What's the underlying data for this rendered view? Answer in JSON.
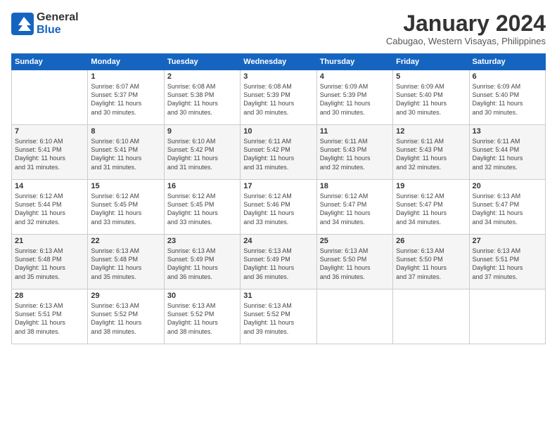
{
  "header": {
    "logo_line1": "General",
    "logo_line2": "Blue",
    "month": "January 2024",
    "location": "Cabugao, Western Visayas, Philippines"
  },
  "days_of_week": [
    "Sunday",
    "Monday",
    "Tuesday",
    "Wednesday",
    "Thursday",
    "Friday",
    "Saturday"
  ],
  "weeks": [
    [
      {
        "day": "",
        "text": ""
      },
      {
        "day": "1",
        "text": "Sunrise: 6:07 AM\nSunset: 5:37 PM\nDaylight: 11 hours\nand 30 minutes."
      },
      {
        "day": "2",
        "text": "Sunrise: 6:08 AM\nSunset: 5:38 PM\nDaylight: 11 hours\nand 30 minutes."
      },
      {
        "day": "3",
        "text": "Sunrise: 6:08 AM\nSunset: 5:39 PM\nDaylight: 11 hours\nand 30 minutes."
      },
      {
        "day": "4",
        "text": "Sunrise: 6:09 AM\nSunset: 5:39 PM\nDaylight: 11 hours\nand 30 minutes."
      },
      {
        "day": "5",
        "text": "Sunrise: 6:09 AM\nSunset: 5:40 PM\nDaylight: 11 hours\nand 30 minutes."
      },
      {
        "day": "6",
        "text": "Sunrise: 6:09 AM\nSunset: 5:40 PM\nDaylight: 11 hours\nand 30 minutes."
      }
    ],
    [
      {
        "day": "7",
        "text": "Sunrise: 6:10 AM\nSunset: 5:41 PM\nDaylight: 11 hours\nand 31 minutes."
      },
      {
        "day": "8",
        "text": "Sunrise: 6:10 AM\nSunset: 5:41 PM\nDaylight: 11 hours\nand 31 minutes."
      },
      {
        "day": "9",
        "text": "Sunrise: 6:10 AM\nSunset: 5:42 PM\nDaylight: 11 hours\nand 31 minutes."
      },
      {
        "day": "10",
        "text": "Sunrise: 6:11 AM\nSunset: 5:42 PM\nDaylight: 11 hours\nand 31 minutes."
      },
      {
        "day": "11",
        "text": "Sunrise: 6:11 AM\nSunset: 5:43 PM\nDaylight: 11 hours\nand 32 minutes."
      },
      {
        "day": "12",
        "text": "Sunrise: 6:11 AM\nSunset: 5:43 PM\nDaylight: 11 hours\nand 32 minutes."
      },
      {
        "day": "13",
        "text": "Sunrise: 6:11 AM\nSunset: 5:44 PM\nDaylight: 11 hours\nand 32 minutes."
      }
    ],
    [
      {
        "day": "14",
        "text": "Sunrise: 6:12 AM\nSunset: 5:44 PM\nDaylight: 11 hours\nand 32 minutes."
      },
      {
        "day": "15",
        "text": "Sunrise: 6:12 AM\nSunset: 5:45 PM\nDaylight: 11 hours\nand 33 minutes."
      },
      {
        "day": "16",
        "text": "Sunrise: 6:12 AM\nSunset: 5:45 PM\nDaylight: 11 hours\nand 33 minutes."
      },
      {
        "day": "17",
        "text": "Sunrise: 6:12 AM\nSunset: 5:46 PM\nDaylight: 11 hours\nand 33 minutes."
      },
      {
        "day": "18",
        "text": "Sunrise: 6:12 AM\nSunset: 5:47 PM\nDaylight: 11 hours\nand 34 minutes."
      },
      {
        "day": "19",
        "text": "Sunrise: 6:12 AM\nSunset: 5:47 PM\nDaylight: 11 hours\nand 34 minutes."
      },
      {
        "day": "20",
        "text": "Sunrise: 6:13 AM\nSunset: 5:47 PM\nDaylight: 11 hours\nand 34 minutes."
      }
    ],
    [
      {
        "day": "21",
        "text": "Sunrise: 6:13 AM\nSunset: 5:48 PM\nDaylight: 11 hours\nand 35 minutes."
      },
      {
        "day": "22",
        "text": "Sunrise: 6:13 AM\nSunset: 5:48 PM\nDaylight: 11 hours\nand 35 minutes."
      },
      {
        "day": "23",
        "text": "Sunrise: 6:13 AM\nSunset: 5:49 PM\nDaylight: 11 hours\nand 36 minutes."
      },
      {
        "day": "24",
        "text": "Sunrise: 6:13 AM\nSunset: 5:49 PM\nDaylight: 11 hours\nand 36 minutes."
      },
      {
        "day": "25",
        "text": "Sunrise: 6:13 AM\nSunset: 5:50 PM\nDaylight: 11 hours\nand 36 minutes."
      },
      {
        "day": "26",
        "text": "Sunrise: 6:13 AM\nSunset: 5:50 PM\nDaylight: 11 hours\nand 37 minutes."
      },
      {
        "day": "27",
        "text": "Sunrise: 6:13 AM\nSunset: 5:51 PM\nDaylight: 11 hours\nand 37 minutes."
      }
    ],
    [
      {
        "day": "28",
        "text": "Sunrise: 6:13 AM\nSunset: 5:51 PM\nDaylight: 11 hours\nand 38 minutes."
      },
      {
        "day": "29",
        "text": "Sunrise: 6:13 AM\nSunset: 5:52 PM\nDaylight: 11 hours\nand 38 minutes."
      },
      {
        "day": "30",
        "text": "Sunrise: 6:13 AM\nSunset: 5:52 PM\nDaylight: 11 hours\nand 38 minutes."
      },
      {
        "day": "31",
        "text": "Sunrise: 6:13 AM\nSunset: 5:52 PM\nDaylight: 11 hours\nand 39 minutes."
      },
      {
        "day": "",
        "text": ""
      },
      {
        "day": "",
        "text": ""
      },
      {
        "day": "",
        "text": ""
      }
    ]
  ]
}
